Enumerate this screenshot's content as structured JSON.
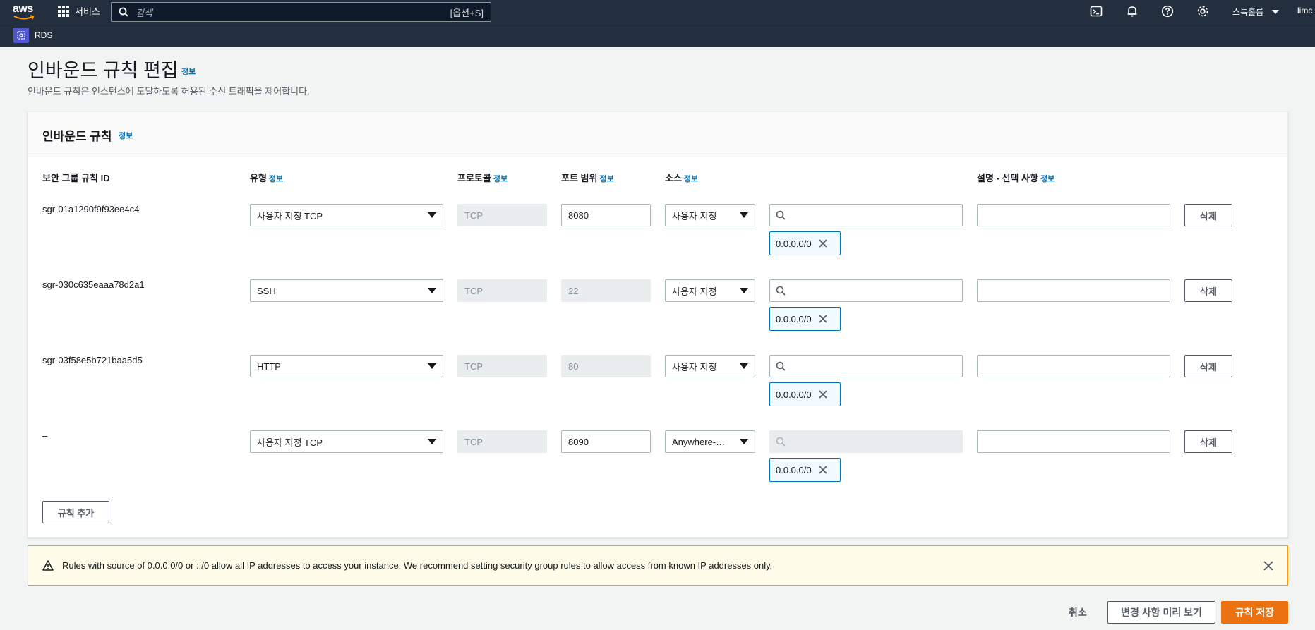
{
  "topnav": {
    "logo_text": "aws",
    "services_label": "서비스",
    "search_placeholder": "검색",
    "search_shortcut": "[옵션+S]",
    "region_label": "스톡홀름",
    "user_label": "limc",
    "icons": [
      "terminal-icon",
      "bell-icon",
      "help-icon",
      "settings-icon"
    ]
  },
  "subnav": {
    "service_label": "RDS"
  },
  "page": {
    "title": "인바운드 규칙 편집",
    "info_label": "정보",
    "description": "인바운드 규칙은 인스턴스에 도달하도록 허용된 수신 트래픽을 제어합니다."
  },
  "panel": {
    "title": "인바운드 규칙",
    "columns": {
      "rule_id": "보안 그룹 규칙 ID",
      "type": "유형",
      "protocol": "프로토콜",
      "port_range": "포트 범위",
      "source": "소스",
      "description": "설명 - 선택 사항"
    },
    "rules": [
      {
        "id": "sgr-01a1290f9f93ee4c4",
        "type": "사용자 지정 TCP",
        "protocol": "TCP",
        "port": "8080",
        "port_editable": true,
        "source_type": "사용자 지정",
        "source_search_enabled": true,
        "cidr": "0.0.0.0/0",
        "description": "",
        "delete_label": "삭제"
      },
      {
        "id": "sgr-030c635eaaa78d2a1",
        "type": "SSH",
        "protocol": "TCP",
        "port": "22",
        "port_editable": false,
        "source_type": "사용자 지정",
        "source_search_enabled": true,
        "cidr": "0.0.0.0/0",
        "description": "",
        "delete_label": "삭제"
      },
      {
        "id": "sgr-03f58e5b721baa5d5",
        "type": "HTTP",
        "protocol": "TCP",
        "port": "80",
        "port_editable": false,
        "source_type": "사용자 지정",
        "source_search_enabled": true,
        "cidr": "0.0.0.0/0",
        "description": "",
        "delete_label": "삭제"
      },
      {
        "id": "–",
        "type": "사용자 지정 TCP",
        "protocol": "TCP",
        "port": "8090",
        "port_editable": true,
        "source_type": "Anywhere-…",
        "source_search_enabled": false,
        "cidr": "0.0.0.0/0",
        "description": "",
        "delete_label": "삭제"
      }
    ],
    "add_rule_label": "규칙 추가"
  },
  "alert": {
    "message": "Rules with source of 0.0.0.0/0 or ::/0 allow all IP addresses to access your instance. We recommend setting security group rules to allow access from known IP addresses only."
  },
  "footer": {
    "cancel_label": "취소",
    "preview_label": "변경 사항 미리 보기",
    "save_label": "규칙 저장"
  },
  "colors": {
    "nav_bg": "#232f3e",
    "link": "#0073bb",
    "primary": "#ec7211",
    "warning_border": "#ff9900",
    "warning_bg": "#fffce9"
  }
}
